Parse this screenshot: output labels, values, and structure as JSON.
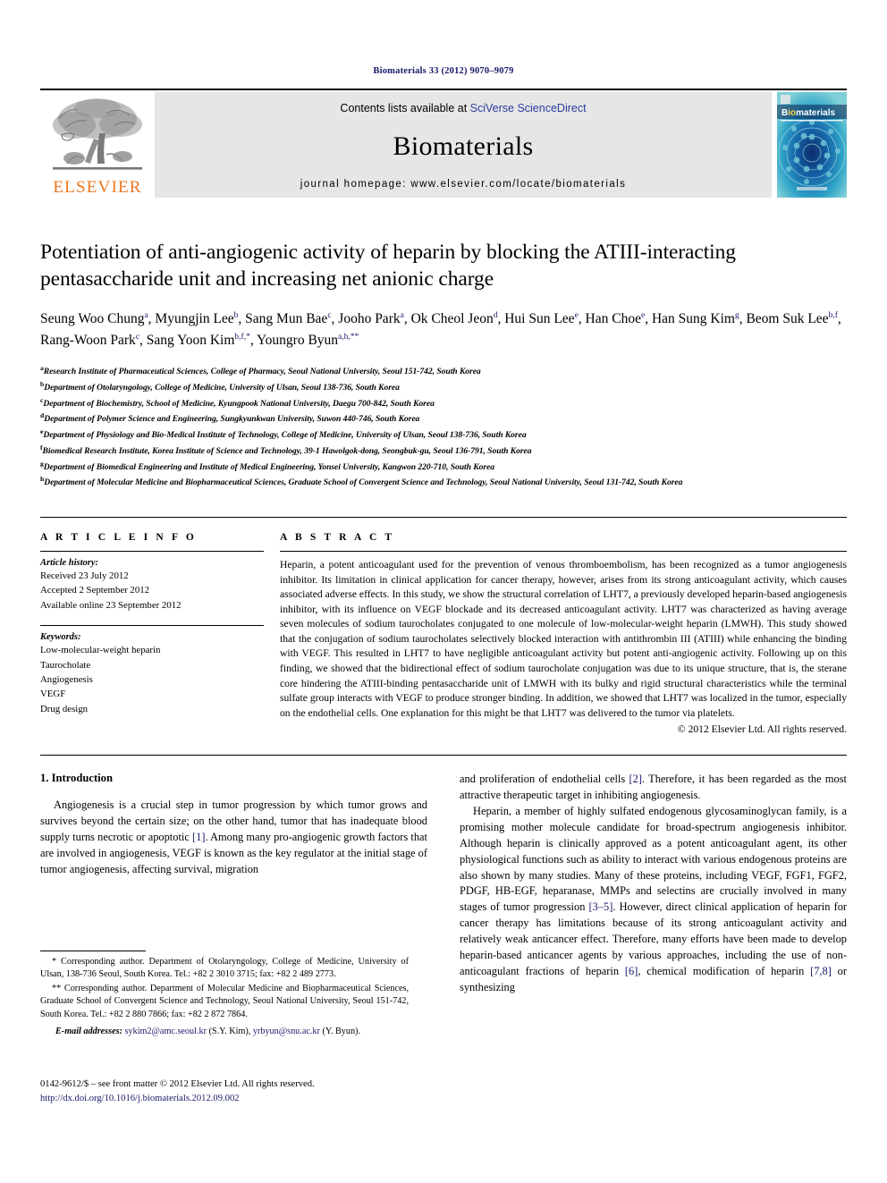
{
  "running_head": "Biomaterials 33 (2012) 9070–9079",
  "masthead": {
    "publisher_name": "ELSEVIER",
    "contents_prefix": "Contents lists available at ",
    "contents_link": "SciVerse ScienceDirect",
    "journal_name": "Biomaterials",
    "homepage": "journal homepage: www.elsevier.com/locate/biomaterials",
    "cover_title": "Biomaterials"
  },
  "article": {
    "title": "Potentiation of anti-angiogenic activity of heparin by blocking the ATIII-interacting pentasaccharide unit and increasing net anionic charge",
    "authors": [
      {
        "name": "Seung Woo Chung",
        "marks": "a"
      },
      {
        "name": "Myungjin Lee",
        "marks": "b"
      },
      {
        "name": "Sang Mun Bae",
        "marks": "c"
      },
      {
        "name": "Jooho Park",
        "marks": "a"
      },
      {
        "name": "Ok Cheol Jeon",
        "marks": "d"
      },
      {
        "name": "Hui Sun Lee",
        "marks": "e"
      },
      {
        "name": "Han Choe",
        "marks": "e"
      },
      {
        "name": "Han Sung Kim",
        "marks": "g"
      },
      {
        "name": "Beom Suk Lee",
        "marks": "b,f"
      },
      {
        "name": "Rang-Woon Park",
        "marks": "c"
      },
      {
        "name": "Sang Yoon Kim",
        "marks": "b,f,*"
      },
      {
        "name": "Youngro Byun",
        "marks": "a,h,**"
      }
    ],
    "affiliations": [
      {
        "mark": "a",
        "text": "Research Institute of Pharmaceutical Sciences, College of Pharmacy, Seoul National University, Seoul 151-742, South Korea"
      },
      {
        "mark": "b",
        "text": "Department of Otolaryngology, College of Medicine, University of Ulsan, Seoul 138-736, South Korea"
      },
      {
        "mark": "c",
        "text": "Department of Biochemistry, School of Medicine, Kyungpook National University, Daegu 700-842, South Korea"
      },
      {
        "mark": "d",
        "text": "Department of Polymer Science and Engineering, Sungkyunkwan University, Suwon 440-746, South Korea"
      },
      {
        "mark": "e",
        "text": "Department of Physiology and Bio-Medical Institute of Technology, College of Medicine, University of Ulsan, Seoul 138-736, South Korea"
      },
      {
        "mark": "f",
        "text": "Biomedical Research Institute, Korea Institute of Science and Technology, 39-1 Hawolgok-dong, Seongbuk-gu, Seoul 136-791, South Korea"
      },
      {
        "mark": "g",
        "text": "Department of Biomedical Engineering and Institute of Medical Engineering, Yonsei University, Kangwon 220-710, South Korea"
      },
      {
        "mark": "h",
        "text": "Department of Molecular Medicine and Biopharmaceutical Sciences, Graduate School of Convergent Science and Technology, Seoul National University, Seoul 131-742, South Korea"
      }
    ]
  },
  "article_info": {
    "heading": "A R T I C L E   I N F O",
    "history_title": "Article history:",
    "history": [
      "Received 23 July 2012",
      "Accepted 2 September 2012",
      "Available online 23 September 2012"
    ],
    "keywords_title": "Keywords:",
    "keywords": [
      "Low-molecular-weight heparin",
      "Taurocholate",
      "Angiogenesis",
      "VEGF",
      "Drug design"
    ]
  },
  "abstract": {
    "heading": "A B S T R A C T",
    "text": "Heparin, a potent anticoagulant used for the prevention of venous thromboembolism, has been recognized as a tumor angiogenesis inhibitor. Its limitation in clinical application for cancer therapy, however, arises from its strong anticoagulant activity, which causes associated adverse effects. In this study, we show the structural correlation of LHT7, a previously developed heparin-based angiogenesis inhibitor, with its influence on VEGF blockade and its decreased anticoagulant activity. LHT7 was characterized as having average seven molecules of sodium taurocholates conjugated to one molecule of low-molecular-weight heparin (LMWH). This study showed that the conjugation of sodium taurocholates selectively blocked interaction with antithrombin III (ATIII) while enhancing the binding with VEGF. This resulted in LHT7 to have negligible anticoagulant activity but potent anti-angiogenic activity. Following up on this finding, we showed that the bidirectional effect of sodium taurocholate conjugation was due to its unique structure, that is, the sterane core hindering the ATIII-binding pentasaccharide unit of LMWH with its bulky and rigid structural characteristics while the terminal sulfate group interacts with VEGF to produce stronger binding. In addition, we showed that LHT7 was localized in the tumor, especially on the endothelial cells. One explanation for this might be that LHT7 was delivered to the tumor via platelets.",
    "copyright": "© 2012 Elsevier Ltd. All rights reserved."
  },
  "body": {
    "section_heading": "1. Introduction",
    "left_paragraph_1_a": "Angiogenesis is a crucial step in tumor progression by which tumor grows and survives beyond the certain size; on the other hand, tumor that has inadequate blood supply turns necrotic or apoptotic ",
    "left_ref_1": "[1]",
    "left_paragraph_1_b": ". Among many pro-angiogenic growth factors that are involved in angiogenesis, VEGF is known as the key regulator at the initial stage of tumor angiogenesis, affecting survival, migration",
    "right_paragraph_1_a": "and proliferation of endothelial cells ",
    "right_ref_2": "[2]",
    "right_paragraph_1_b": ". Therefore, it has been regarded as the most attractive therapeutic target in inhibiting angiogenesis.",
    "right_paragraph_2_a": "Heparin, a member of highly sulfated endogenous glycosaminoglycan family, is a promising mother molecule candidate for broad-spectrum angiogenesis inhibitor. Although heparin is clinically approved as a potent anticoagulant agent, its other physiological functions such as ability to interact with various endogenous proteins are also shown by many studies. Many of these proteins, including VEGF, FGF1, FGF2, PDGF, HB-EGF, heparanase, MMPs and selectins are crucially involved in many stages of tumor progression ",
    "right_ref_35": "[3–5]",
    "right_paragraph_2_b": ". However, direct clinical application of heparin for cancer therapy has limitations because of its strong anticoagulant activity and relatively weak anticancer effect. Therefore, many efforts have been made to develop heparin-based anticancer agents by various approaches, including the use of non-anticoagulant fractions of heparin ",
    "right_ref_6": "[6]",
    "right_paragraph_2_c": ", chemical modification of heparin ",
    "right_ref_78": "[7,8]",
    "right_paragraph_2_d": " or synthesizing"
  },
  "footnotes": {
    "note1": "* Corresponding author. Department of Otolaryngology, College of Medicine, University of Ulsan, 138-736 Seoul, South Korea. Tel.: +82 2 3010 3715; fax: +82 2 489 2773.",
    "note2": "** Corresponding author. Department of Molecular Medicine and Biopharmaceutical Sciences, Graduate School of Convergent Science and Technology, Seoul National University, Seoul 151-742, South Korea. Tel.: +82 2 880 7866; fax: +82 2 872 7864.",
    "email_label": "E-mail addresses:",
    "email1": "sykim2@amc.seoul.kr",
    "email1_owner": "(S.Y. Kim),",
    "email2": "yrbyun@snu.ac.kr",
    "email2_owner": "(Y. Byun)."
  },
  "imprint": {
    "line1": "0142-9612/$ – see front matter © 2012 Elsevier Ltd. All rights reserved.",
    "doi": "http://dx.doi.org/10.1016/j.biomaterials.2012.09.002"
  },
  "colors": {
    "link_blue": "#19196b",
    "elsevier_orange": "#E87722",
    "masthead_grey": "#e6e6e6"
  }
}
